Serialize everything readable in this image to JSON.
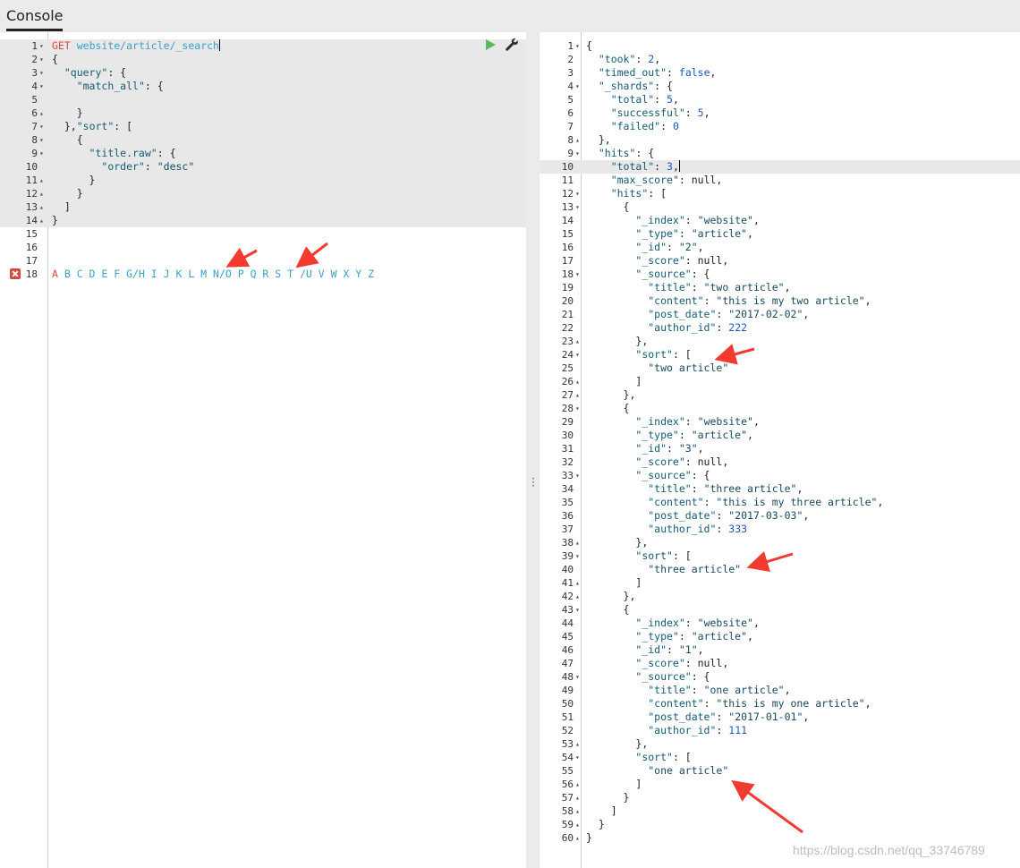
{
  "header": {
    "tab_label": "Console"
  },
  "request": {
    "method": "GET",
    "url": "website/article/_search",
    "lines": [
      {
        "n": "1",
        "fold": "▾",
        "html": "<span class=\"m\">GET</span> <span class=\"u\">website/article/_search</span>"
      },
      {
        "n": "2",
        "fold": "▾",
        "html": "<span class=\"p\">{</span>"
      },
      {
        "n": "3",
        "fold": "▾",
        "html": "  <span class=\"k\">\"query\"</span><span class=\"p\">: {</span>"
      },
      {
        "n": "4",
        "fold": "▾",
        "html": "    <span class=\"k\">\"match_all\"</span><span class=\"p\">: {</span>"
      },
      {
        "n": "5",
        "fold": "",
        "html": ""
      },
      {
        "n": "6",
        "fold": "▴",
        "html": "    <span class=\"p\">}</span>"
      },
      {
        "n": "7",
        "fold": "▾",
        "html": "  <span class=\"p\">},</span><span class=\"k\">\"sort\"</span><span class=\"p\">: [</span>"
      },
      {
        "n": "8",
        "fold": "▾",
        "html": "    <span class=\"p\">{</span>"
      },
      {
        "n": "9",
        "fold": "▾",
        "html": "      <span class=\"k\">\"title.raw\"</span><span class=\"p\">: {</span>"
      },
      {
        "n": "10",
        "fold": "",
        "html": "        <span class=\"k\">\"order\"</span><span class=\"p\">: </span><span class=\"s\">\"desc\"</span>"
      },
      {
        "n": "11",
        "fold": "▴",
        "html": "      <span class=\"p\">}</span>"
      },
      {
        "n": "12",
        "fold": "▴",
        "html": "    <span class=\"p\">}</span>"
      },
      {
        "n": "13",
        "fold": "▴",
        "html": "  <span class=\"p\">]</span>"
      },
      {
        "n": "14",
        "fold": "▴",
        "html": "<span class=\"p\">}</span>"
      },
      {
        "n": "15",
        "fold": "",
        "html": ""
      },
      {
        "n": "16",
        "fold": "",
        "html": ""
      },
      {
        "n": "17",
        "fold": "",
        "html": ""
      }
    ],
    "alphabet_line": {
      "n": "18",
      "first": "A",
      "rest": " B C D E F G/H I J K L M N/O P Q R S T /U V W X Y Z"
    }
  },
  "response": {
    "lines": [
      {
        "n": "1",
        "fold": "▾",
        "html": "<span class=\"p\">{</span>"
      },
      {
        "n": "2",
        "fold": "",
        "html": "  <span class=\"k\">\"took\"</span><span class=\"p\">: </span><span class=\"n\">2</span><span class=\"p\">,</span>"
      },
      {
        "n": "3",
        "fold": "",
        "html": "  <span class=\"k\">\"timed_out\"</span><span class=\"p\">: </span><span class=\"b\">false</span><span class=\"p\">,</span>"
      },
      {
        "n": "4",
        "fold": "▾",
        "html": "  <span class=\"k\">\"_shards\"</span><span class=\"p\">: {</span>"
      },
      {
        "n": "5",
        "fold": "",
        "html": "    <span class=\"k\">\"total\"</span><span class=\"p\">: </span><span class=\"n\">5</span><span class=\"p\">,</span>"
      },
      {
        "n": "6",
        "fold": "",
        "html": "    <span class=\"k\">\"successful\"</span><span class=\"p\">: </span><span class=\"n\">5</span><span class=\"p\">,</span>"
      },
      {
        "n": "7",
        "fold": "",
        "html": "    <span class=\"k\">\"failed\"</span><span class=\"p\">: </span><span class=\"n\">0</span>"
      },
      {
        "n": "8",
        "fold": "▴",
        "html": "  <span class=\"p\">},</span>"
      },
      {
        "n": "9",
        "fold": "▾",
        "html": "  <span class=\"k\">\"hits\"</span><span class=\"p\">: {</span>"
      },
      {
        "n": "10",
        "fold": "",
        "html": "    <span class=\"k\">\"total\"</span><span class=\"p\">: </span><span class=\"n\">3</span><span class=\"p\">,</span>",
        "active": true
      },
      {
        "n": "11",
        "fold": "",
        "html": "    <span class=\"k\">\"max_score\"</span><span class=\"p\">: null,</span>"
      },
      {
        "n": "12",
        "fold": "▾",
        "html": "    <span class=\"k\">\"hits\"</span><span class=\"p\">: [</span>"
      },
      {
        "n": "13",
        "fold": "▾",
        "html": "      <span class=\"p\">{</span>"
      },
      {
        "n": "14",
        "fold": "",
        "html": "        <span class=\"k\">\"_index\"</span><span class=\"p\">: </span><span class=\"s\">\"website\"</span><span class=\"p\">,</span>"
      },
      {
        "n": "15",
        "fold": "",
        "html": "        <span class=\"k\">\"_type\"</span><span class=\"p\">: </span><span class=\"s\">\"article\"</span><span class=\"p\">,</span>"
      },
      {
        "n": "16",
        "fold": "",
        "html": "        <span class=\"k\">\"_id\"</span><span class=\"p\">: </span><span class=\"s\">\"2\"</span><span class=\"p\">,</span>"
      },
      {
        "n": "17",
        "fold": "",
        "html": "        <span class=\"k\">\"_score\"</span><span class=\"p\">: null,</span>"
      },
      {
        "n": "18",
        "fold": "▾",
        "html": "        <span class=\"k\">\"_source\"</span><span class=\"p\">: {</span>"
      },
      {
        "n": "19",
        "fold": "",
        "html": "          <span class=\"k\">\"title\"</span><span class=\"p\">: </span><span class=\"s\">\"two article\"</span><span class=\"p\">,</span>"
      },
      {
        "n": "20",
        "fold": "",
        "html": "          <span class=\"k\">\"content\"</span><span class=\"p\">: </span><span class=\"s\">\"this is my two article\"</span><span class=\"p\">,</span>"
      },
      {
        "n": "21",
        "fold": "",
        "html": "          <span class=\"k\">\"post_date\"</span><span class=\"p\">: </span><span class=\"s\">\"2017-02-02\"</span><span class=\"p\">,</span>"
      },
      {
        "n": "22",
        "fold": "",
        "html": "          <span class=\"k\">\"author_id\"</span><span class=\"p\">: </span><span class=\"n\">222</span>"
      },
      {
        "n": "23",
        "fold": "▴",
        "html": "        <span class=\"p\">},</span>"
      },
      {
        "n": "24",
        "fold": "▾",
        "html": "        <span class=\"k\">\"sort\"</span><span class=\"p\">: [</span>"
      },
      {
        "n": "25",
        "fold": "",
        "html": "          <span class=\"s\">\"two article\"</span>"
      },
      {
        "n": "26",
        "fold": "▴",
        "html": "        <span class=\"p\">]</span>"
      },
      {
        "n": "27",
        "fold": "▴",
        "html": "      <span class=\"p\">},</span>"
      },
      {
        "n": "28",
        "fold": "▾",
        "html": "      <span class=\"p\">{</span>"
      },
      {
        "n": "29",
        "fold": "",
        "html": "        <span class=\"k\">\"_index\"</span><span class=\"p\">: </span><span class=\"s\">\"website\"</span><span class=\"p\">,</span>"
      },
      {
        "n": "30",
        "fold": "",
        "html": "        <span class=\"k\">\"_type\"</span><span class=\"p\">: </span><span class=\"s\">\"article\"</span><span class=\"p\">,</span>"
      },
      {
        "n": "31",
        "fold": "",
        "html": "        <span class=\"k\">\"_id\"</span><span class=\"p\">: </span><span class=\"s\">\"3\"</span><span class=\"p\">,</span>"
      },
      {
        "n": "32",
        "fold": "",
        "html": "        <span class=\"k\">\"_score\"</span><span class=\"p\">: null,</span>"
      },
      {
        "n": "33",
        "fold": "▾",
        "html": "        <span class=\"k\">\"_source\"</span><span class=\"p\">: {</span>"
      },
      {
        "n": "34",
        "fold": "",
        "html": "          <span class=\"k\">\"title\"</span><span class=\"p\">: </span><span class=\"s\">\"three article\"</span><span class=\"p\">,</span>"
      },
      {
        "n": "35",
        "fold": "",
        "html": "          <span class=\"k\">\"content\"</span><span class=\"p\">: </span><span class=\"s\">\"this is my three article\"</span><span class=\"p\">,</span>"
      },
      {
        "n": "36",
        "fold": "",
        "html": "          <span class=\"k\">\"post_date\"</span><span class=\"p\">: </span><span class=\"s\">\"2017-03-03\"</span><span class=\"p\">,</span>"
      },
      {
        "n": "37",
        "fold": "",
        "html": "          <span class=\"k\">\"author_id\"</span><span class=\"p\">: </span><span class=\"n\">333</span>"
      },
      {
        "n": "38",
        "fold": "▴",
        "html": "        <span class=\"p\">},</span>"
      },
      {
        "n": "39",
        "fold": "▾",
        "html": "        <span class=\"k\">\"sort\"</span><span class=\"p\">: [</span>"
      },
      {
        "n": "40",
        "fold": "",
        "html": "          <span class=\"s\">\"three article\"</span>"
      },
      {
        "n": "41",
        "fold": "▴",
        "html": "        <span class=\"p\">]</span>"
      },
      {
        "n": "42",
        "fold": "▴",
        "html": "      <span class=\"p\">},</span>"
      },
      {
        "n": "43",
        "fold": "▾",
        "html": "      <span class=\"p\">{</span>"
      },
      {
        "n": "44",
        "fold": "",
        "html": "        <span class=\"k\">\"_index\"</span><span class=\"p\">: </span><span class=\"s\">\"website\"</span><span class=\"p\">,</span>"
      },
      {
        "n": "45",
        "fold": "",
        "html": "        <span class=\"k\">\"_type\"</span><span class=\"p\">: </span><span class=\"s\">\"article\"</span><span class=\"p\">,</span>"
      },
      {
        "n": "46",
        "fold": "",
        "html": "        <span class=\"k\">\"_id\"</span><span class=\"p\">: </span><span class=\"s\">\"1\"</span><span class=\"p\">,</span>"
      },
      {
        "n": "47",
        "fold": "",
        "html": "        <span class=\"k\">\"_score\"</span><span class=\"p\">: null,</span>"
      },
      {
        "n": "48",
        "fold": "▾",
        "html": "        <span class=\"k\">\"_source\"</span><span class=\"p\">: {</span>"
      },
      {
        "n": "49",
        "fold": "",
        "html": "          <span class=\"k\">\"title\"</span><span class=\"p\">: </span><span class=\"s\">\"one article\"</span><span class=\"p\">,</span>"
      },
      {
        "n": "50",
        "fold": "",
        "html": "          <span class=\"k\">\"content\"</span><span class=\"p\">: </span><span class=\"s\">\"this is my one article\"</span><span class=\"p\">,</span>"
      },
      {
        "n": "51",
        "fold": "",
        "html": "          <span class=\"k\">\"post_date\"</span><span class=\"p\">: </span><span class=\"s\">\"2017-01-01\"</span><span class=\"p\">,</span>"
      },
      {
        "n": "52",
        "fold": "",
        "html": "          <span class=\"k\">\"author_id\"</span><span class=\"p\">: </span><span class=\"n\">111</span>"
      },
      {
        "n": "53",
        "fold": "▴",
        "html": "        <span class=\"p\">},</span>"
      },
      {
        "n": "54",
        "fold": "▾",
        "html": "        <span class=\"k\">\"sort\"</span><span class=\"p\">: [</span>"
      },
      {
        "n": "55",
        "fold": "",
        "html": "          <span class=\"s\">\"one article\"</span>"
      },
      {
        "n": "56",
        "fold": "▴",
        "html": "        <span class=\"p\">]</span>"
      },
      {
        "n": "57",
        "fold": "▴",
        "html": "      <span class=\"p\">}</span>"
      },
      {
        "n": "58",
        "fold": "▴",
        "html": "    <span class=\"p\">]</span>"
      },
      {
        "n": "59",
        "fold": "▴",
        "html": "  <span class=\"p\">}</span>"
      },
      {
        "n": "60",
        "fold": "▴",
        "html": "<span class=\"p\">}</span>"
      }
    ]
  },
  "icons": {
    "run": "play-icon",
    "settings": "wrench-icon",
    "error": "error-icon",
    "resize": "drag-handle-icon"
  },
  "colors": {
    "method": "#e04a3f",
    "url": "#3aa1c8",
    "key": "#125c76",
    "number": "#1f5ab8",
    "run": "#5cb85c",
    "annotation_arrow": "#f23b30"
  },
  "watermark": "https://blog.csdn.net/qq_33746789"
}
